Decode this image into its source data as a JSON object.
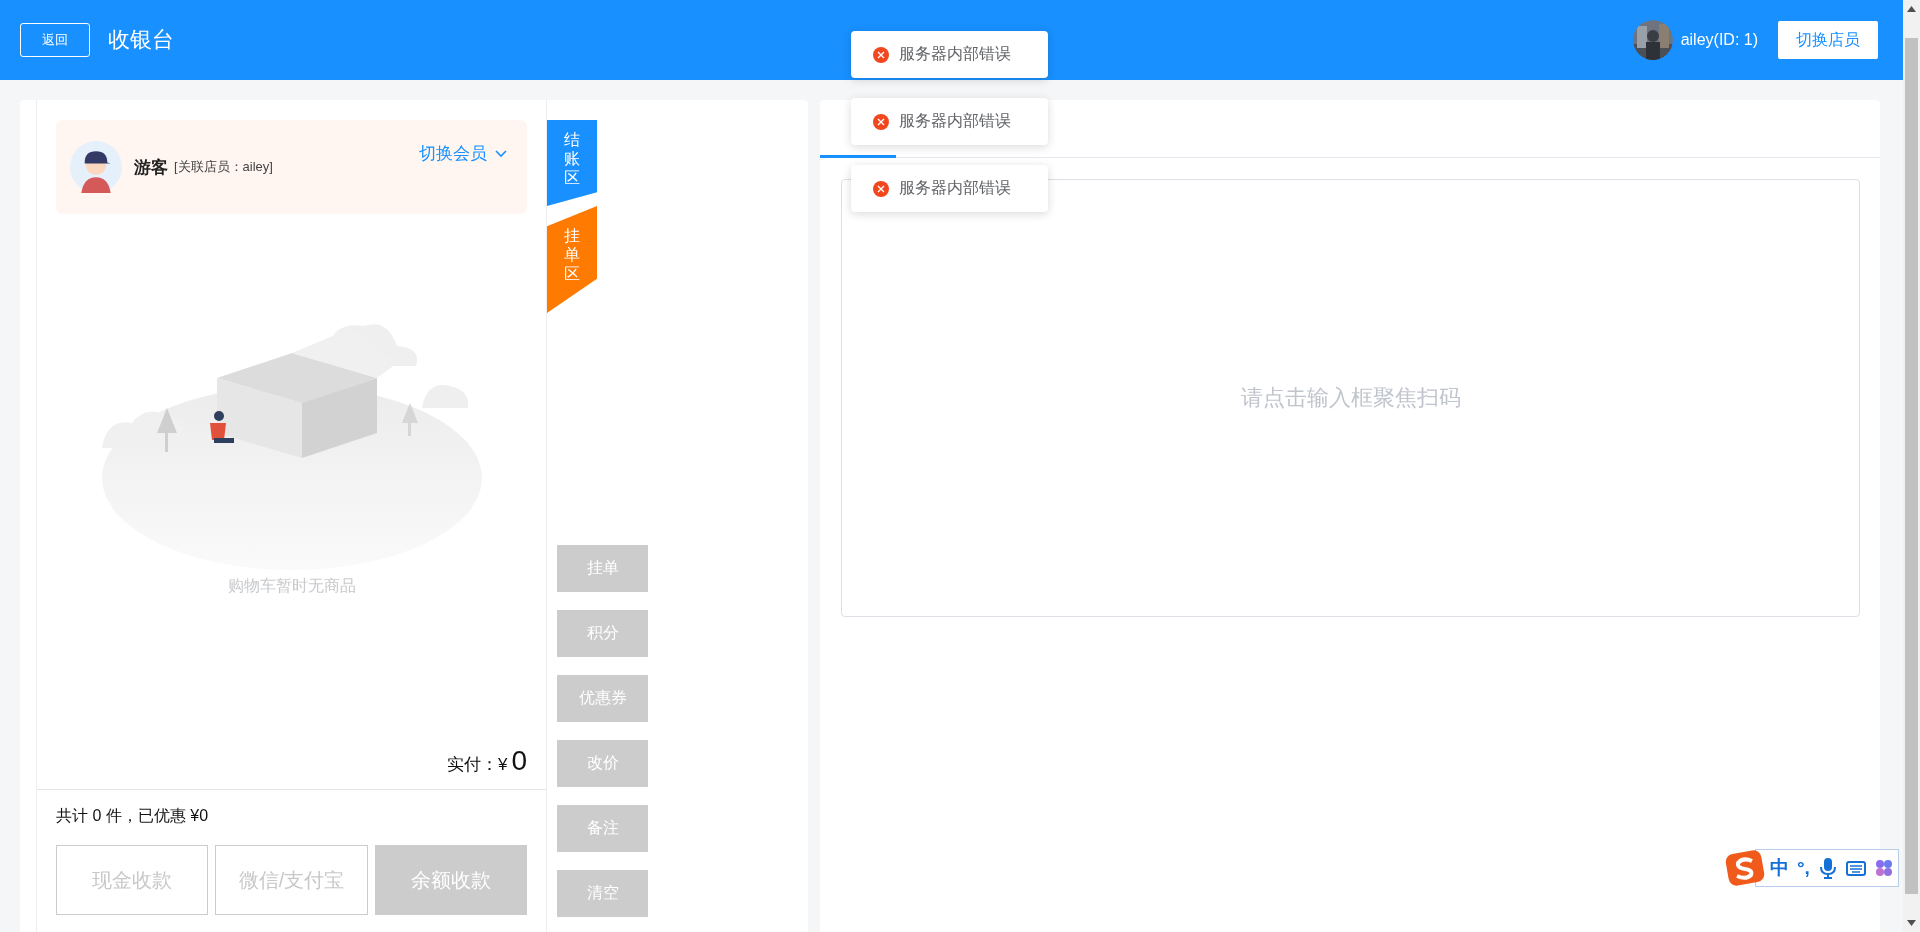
{
  "header": {
    "back_button": "返回",
    "title": "收银台",
    "user": "ailey(ID: 1)",
    "switch_button": "切换店员"
  },
  "toasts": [
    {
      "message": "服务器内部错误"
    },
    {
      "message": "服务器内部错误"
    },
    {
      "message": "服务器内部错误"
    }
  ],
  "member": {
    "name": "游客",
    "staff": "[关联店员：ailey]",
    "switch_label": "切换会员"
  },
  "side_tabs": [
    {
      "label": "结账区",
      "color": "#1890ff"
    },
    {
      "label": "挂单区",
      "color": "#ff7a00"
    }
  ],
  "cart": {
    "empty_text": "购物车暂时无商品",
    "paid_label": "实付：",
    "currency": "¥",
    "paid_amount": "0",
    "summary": "共计 0 件，已优惠 ¥0"
  },
  "payment_buttons": [
    {
      "label": "现金收款",
      "kind": "outline"
    },
    {
      "label": "微信/支付宝",
      "kind": "outline"
    },
    {
      "label": "余额收款",
      "kind": "filled"
    }
  ],
  "actions": [
    "挂单",
    "积分",
    "优惠券",
    "改价",
    "备注",
    "清空"
  ],
  "scan_panel": {
    "tabs": [
      {
        "selected": true
      }
    ],
    "prompt": "请点击输入框聚焦扫码"
  },
  "ime": {
    "mode": "中",
    "punctuation": "°,"
  }
}
